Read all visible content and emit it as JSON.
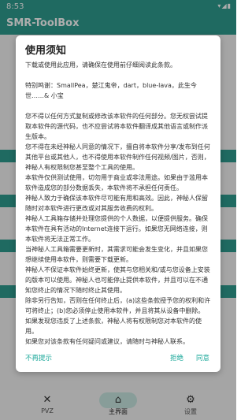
{
  "status_bar": {
    "time": "8:53",
    "icons": "▾◢▮"
  },
  "app_bar": {
    "title": "SMR-ToolBox"
  },
  "bottom_nav": {
    "items": [
      {
        "label": "PVZ",
        "icon": "tools-icon",
        "glyph": "✕"
      },
      {
        "label": "主界面",
        "icon": "home-icon",
        "glyph": "⌂",
        "active": true
      },
      {
        "label": "设置",
        "icon": "gear-icon",
        "glyph": "⚙"
      }
    ]
  },
  "dialog": {
    "title": "使用须知",
    "intro": "下载或使用此应用，请确保在使用前仔细阅读此条款。",
    "thanks": "特别鸣谢：SmallPea，楚江鬼帝，dart，blue-lava，此生今世……& 小宝",
    "paragraphs": [
      "您不得以任何方式复制或修改该本软件的任何部分。您无权尝试提取本软件的源代码，也不应尝试将本软件翻译成其他语言或制作派生版本。",
      "您不得在未经神秘人同意的情况下，擅自将本软件分享/发布到任何其他平台或其他人，也不得使用本软件制作任何视频/图片，否则，神秘人有权限制您甚至整个工具的使用。",
      "本软件仅供测试使用，切勿用于商业或非法用途。如果由于滥用本软件造成您的部分数据丢失，本软件将不承担任何责任。",
      "神秘人致力于确保该本软件尽可能有用和高效。因此，神秘人保留随时对本软件进行更改或对其服务收费的权利。",
      "神秘人工具箱存储并处理您提供的个人数据，以便提供服务。确保本软件在具有活动的Internet连接下运行。如果您无网络连接，则本软件将无法正常工作。",
      "当神秘人工具箱需要更新时，其需求可能会发生变化，并且如果您想继续使用本软件，则需要下载更新。",
      "神秘人不保证本软件始终更新，使其与您相关和/或与您设备上安装的版本可以使用。神秘人也可能停止提供本软件，并且可以在不通知您终止的情况下随时终止其使用。",
      "除非另行告知，否则在任何终止后，(a)这些条款授予您的权利和许可将终止；(b)您必须停止使用本软件，并且将其从设备中删除。",
      "如果发现您违反了上述条款，神秘人将有权限制您对本软件的使用。",
      "如果您对该条款有任何疑问或建议，请随时与神秘人联系。"
    ],
    "buttons": {
      "dont_show": "不再提示",
      "reject": "拒绝",
      "accept": "同意"
    }
  },
  "colors": {
    "primary": "#2e9d8f",
    "accent": "#1ba89a"
  }
}
